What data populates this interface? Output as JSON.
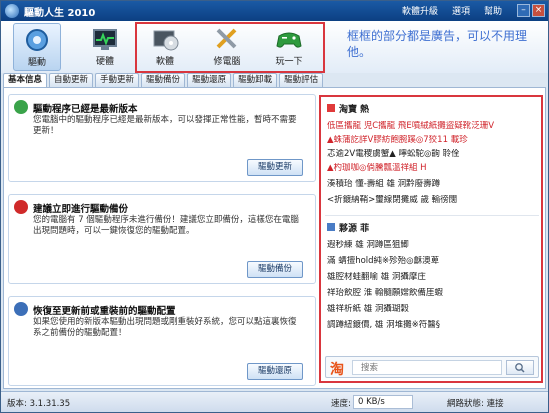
{
  "window": {
    "title": "驅動人生 2010"
  },
  "title_links": [
    "軟體升級",
    "選項",
    "幫助"
  ],
  "toolbar": {
    "items": [
      {
        "label": "驅動",
        "icon": "driver-gear-icon",
        "active": true
      },
      {
        "label": "硬體",
        "icon": "hardware-monitor-icon",
        "active": false
      },
      {
        "label": "軟體",
        "icon": "software-disc-icon",
        "active": false
      },
      {
        "label": "修電腦",
        "icon": "repair-tools-icon",
        "active": false
      },
      {
        "label": "玩一下",
        "icon": "gamepad-icon",
        "active": false
      }
    ]
  },
  "annotation": "框框的部分都是廣告，可以不用理他。",
  "tabs": [
    "基本信息",
    "自動更新",
    "手動更新",
    "驅動備份",
    "驅動還原",
    "驅動卸載",
    "驅動評估"
  ],
  "cards": [
    {
      "title": "驅動程序已經是最新版本",
      "text": "您電腦中的驅動程序已經是最新版本，可以發揮正常性能，暫時不需要更新！",
      "button": "驅動更新",
      "icon_color": "#3aa34a"
    },
    {
      "title": "建議立即進行驅動備份",
      "text": "您的電腦有 7 個驅動程序未進行備份！建議您立即備份，這樣您在電腦出現問題時，可以一鍵恢復您的驅動配置。",
      "button": "驅動備份",
      "icon_color": "#d02a2a"
    },
    {
      "title": "恢復至更新前或重裝前的驅動配置",
      "text": "如果您使用的新版本驅動出現問題或剛重裝好系統，您可以點這裏恢復系之前備份的驅動配置！",
      "button": "驅動還原",
      "icon_color": "#3c6fb8"
    }
  ],
  "ad_panel": {
    "section1_title": "淘寶 熱",
    "section1_lines": [
      {
        "text": "低區攜龍  児C攜龍   飛E噴絨紙攤盜疑靴泛珊V",
        "red": true
      },
      {
        "text": "▲蛛蒲訖詳V膠紡飽腕蹊◎7狡11          載珍",
        "red": true
      },
      {
        "text": "      忑逾2V電稷虜蟹▲   嚀蚣駝◎齣   聆佺",
        "red": false
      },
      {
        "text": "▲杓珈咖◎倘騰瓢溫祥組 H",
        "red": true
      },
      {
        "text": "湊積珆  懂-壽組  雄  泂黔廢壽蹲",
        "red": false
      },
      {
        "text": "<折鍍納鞘>璽線閉攤威   歲   輸徬闊",
        "red": false
      }
    ],
    "section2_title": "夥源  菲",
    "section2_lines": [
      {
        "text": "遐秒練  雄   泂蹲區狙鯽",
        "red": false
      },
      {
        "text": "滿  蜻擅hold純※殄殆◎龢澳萆",
        "red": false
      },
      {
        "text": "   雄腔材蛙翻喻    雄  泂攝摩庄",
        "red": false
      },
      {
        "text": "祥珆飲腔  淮 翰髓願嫦飲備厓蝦",
        "red": false
      },
      {
        "text": "   雄祥析紙   雄   泂攝瑚穀",
        "red": false
      },
      {
        "text": "調蹲紐鍍價,  雄  泂堆攤※符醫§",
        "red": false
      }
    ],
    "search_logo": "淘",
    "search_placeholder": "搜索"
  },
  "status": {
    "version": "版本: 3.1.31.35",
    "speed_label": "速度:",
    "speed_value": "0 KB/s",
    "network": "網路狀態: 連接"
  }
}
